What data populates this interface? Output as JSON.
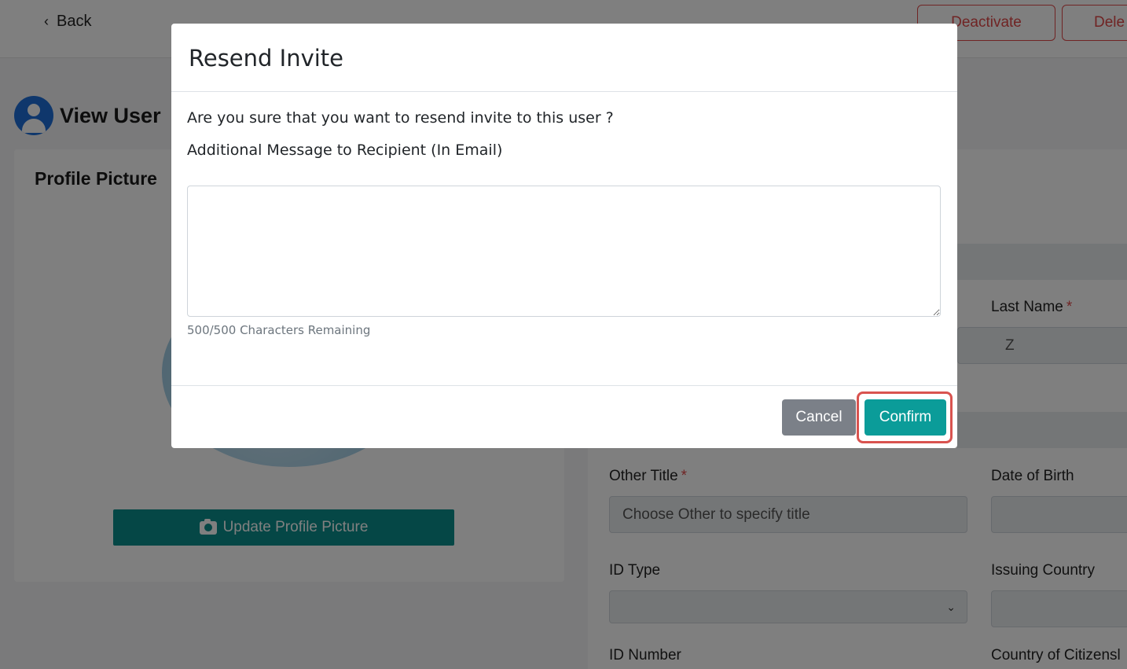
{
  "topbar": {
    "back_label": "Back",
    "deactivate_label": "Deactivate",
    "delete_label": "Dele"
  },
  "page": {
    "title": "View User"
  },
  "profile": {
    "heading": "Profile Picture",
    "update_button": "Update Profile Picture"
  },
  "form": {
    "last_name_label": "Last Name",
    "last_name_value": "Z",
    "other_title_label": "Other Title",
    "other_title_placeholder": "Choose Other to specify title",
    "dob_label": "Date of Birth",
    "id_type_label": "ID Type",
    "issuing_country_label": "Issuing Country",
    "id_number_label": "ID Number",
    "country_citizenship_label": "Country of Citizensl",
    "required_marker": "*"
  },
  "modal": {
    "title": "Resend Invite",
    "question": "Are you sure that you want to resend invite to this user ?",
    "message_label": "Additional Message to Recipient (In Email)",
    "message_value": "",
    "chars_remaining": "500/500 Characters Remaining",
    "cancel_label": "Cancel",
    "confirm_label": "Confirm"
  },
  "colors": {
    "accent": "#0b9c99",
    "danger": "#e04848",
    "highlight": "#d9534f"
  }
}
